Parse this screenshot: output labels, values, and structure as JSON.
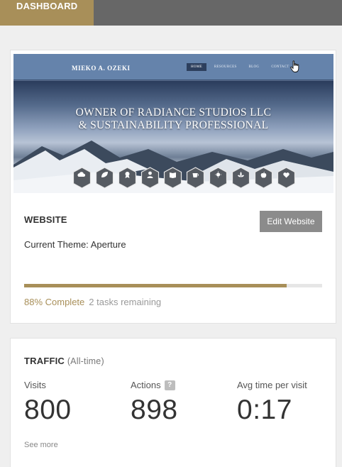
{
  "header": {
    "tab_label": "DASHBOARD"
  },
  "colors": {
    "accent": "#a88f59",
    "topbar": "#676767",
    "button": "#8b8b8b"
  },
  "website": {
    "title": "WEBSITE",
    "edit_button": "Edit Website",
    "theme_line": "Current Theme: Aperture",
    "progress_fraction": 0.88,
    "progress_label": "88% Complete",
    "tasks_remaining": "2 tasks remaining",
    "preview": {
      "brand": "MIEKO A. OZEKI",
      "menu": [
        "HOME",
        "RESOURCES",
        "BLOG",
        "CONTACT"
      ],
      "hero_line1": "OWNER OF RADIANCE STUDIOS LLC",
      "hero_line2": "& SUSTAINABILITY PROFESSIONAL",
      "icons": [
        "cloud-icon",
        "leaf-icon",
        "award-icon",
        "user-icon",
        "book-icon",
        "cup-icon",
        "sun-icon",
        "lotus-icon",
        "apple-icon",
        "heart-icon"
      ]
    }
  },
  "traffic": {
    "title": "TRAFFIC",
    "subtitle": "(All-time)",
    "stats": [
      {
        "label": "Visits",
        "value": "800"
      },
      {
        "label": "Actions",
        "value": "898",
        "help": "?"
      },
      {
        "label": "Avg time per visit",
        "value": "0:17"
      }
    ],
    "see_more": "See more"
  }
}
